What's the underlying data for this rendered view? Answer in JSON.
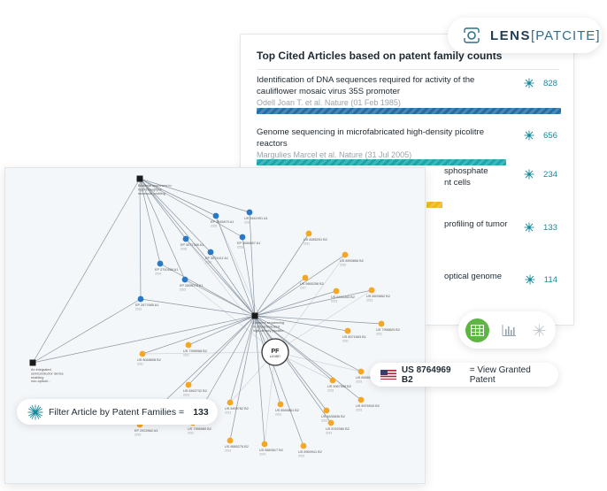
{
  "brand": {
    "lens": "LENS",
    "patcite": "PATCITE",
    "lbracket": "[",
    "rbracket": "]"
  },
  "cited_panel": {
    "title": "Top Cited Articles based on patent family counts",
    "articles": [
      {
        "title": "Identification of DNA sequences required for activity of the cauliflower mosaic virus 35S promoter",
        "meta": "Odell Joan T. et al. Nature (01 Feb 1985)",
        "count": "828",
        "bar_fraction": 1.0,
        "bar_color": "#1e6fa8"
      },
      {
        "title": "Genome sequencing in microfabricated high-density picolitre reactors",
        "meta": "Margulies Marcel et al. Nature (31 Jul 2005)",
        "count": "656",
        "bar_fraction": 0.79,
        "bar_color": "#1ea5ae"
      },
      {
        "title": "sphosphate",
        "title2": "nt cells",
        "count": "234",
        "bar_fraction": 0.2,
        "bar_color": "#f5b41a"
      },
      {
        "title": "profiling of tumor",
        "count": "133"
      },
      {
        "title": "optical genome",
        "count": "114"
      }
    ]
  },
  "graph": {
    "center_label": "PF",
    "center_sub": "s104587",
    "nodes": [
      {
        "label": "EP 3045870 A1",
        "year": "2016"
      },
      {
        "label": "US 9441991 A1",
        "year": "2016"
      },
      {
        "label": "EP 3066857 A1",
        "year": "2016"
      },
      {
        "label": "EP 3077386 A1",
        "year": "2016"
      },
      {
        "label": "EP 3074411 A1",
        "year": "2016"
      },
      {
        "label": "EP 2700466 A1",
        "year": "2014"
      },
      {
        "label": "EP 2808075 A1",
        "year": "2015"
      },
      {
        "label": "EP 2677685 A1",
        "year": "2013"
      },
      {
        "label": "US 8285251 B2",
        "year": "2012"
      },
      {
        "label": "US 8993856 B2",
        "year": "2015"
      },
      {
        "label": "US 9665258 B2",
        "year": "2017"
      },
      {
        "label": "US 8445343 B2",
        "year": "2013"
      },
      {
        "label": "US 8409852 B2",
        "year": "2013"
      },
      {
        "label": "US 8071663 B1",
        "year": "2011"
      },
      {
        "label": "US 7998829 B2",
        "year": "2011"
      },
      {
        "label": "US 8048608 B2",
        "year": "2011"
      },
      {
        "label": "US 7998968 B2",
        "year": "2011"
      },
      {
        "label": "US 8462732 B2",
        "year": "2013"
      },
      {
        "label": "US 8499782 B2",
        "year": "2013"
      },
      {
        "label": "US 8546861 B2",
        "year": "2013"
      },
      {
        "label": "US 8435836 B2",
        "year": "2013"
      },
      {
        "label": "US 9067508 B2",
        "year": "2015"
      },
      {
        "label": "US 8976943 B2",
        "year": "2015"
      },
      {
        "label": "US 8685276 B2",
        "year": "2014"
      },
      {
        "label": "US 8840617 B2",
        "year": "2014"
      },
      {
        "label": "US 8959941 B2",
        "year": "2015"
      },
      {
        "label": "US 8762080 B2",
        "year": "2014"
      },
      {
        "label": "US 8938976 B2",
        "year": "2015"
      },
      {
        "label": "US 7996960 B2",
        "year": "2011"
      },
      {
        "label": "EP 2922862 A3",
        "year": "2015"
      }
    ],
    "articles": [
      {
        "l1": "Bacterial responses to",
        "l2": "high-throughput",
        "l3": "molecular profiling"
      },
      {
        "l1": "Genome sequencing",
        "l2": "in microfabricated",
        "l3": "high-density picolitre"
      },
      {
        "l1": "An integrated",
        "l2": "semiconductor device",
        "l3": "enabling",
        "l4": "non-optical..."
      }
    ]
  },
  "patent_pill": {
    "number": "US 8764969 B2",
    "text": "= View Granted Patent"
  },
  "filter_pill": {
    "text": "Filter Article by Patent Families =",
    "count": "133"
  },
  "icons": {
    "count": "burst-icon",
    "table": "table-icon",
    "chart": "bar-chart-icon",
    "network": "network-icon",
    "flag": "us-flag-icon"
  },
  "colors": {
    "accent_teal": "#1a8a9a",
    "green": "#5fb544",
    "blue_node": "#2878c6",
    "orange_node": "#f5a623"
  }
}
